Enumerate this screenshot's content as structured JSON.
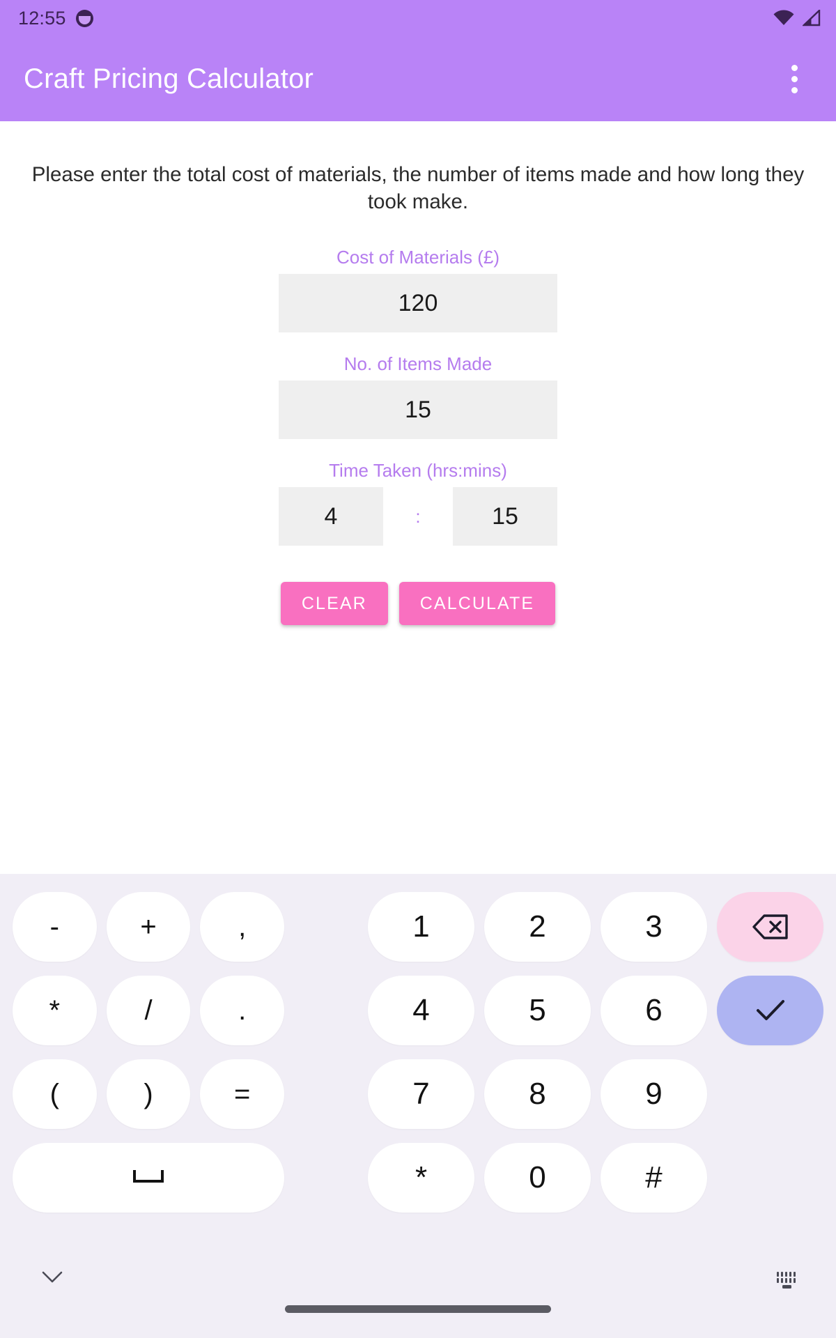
{
  "status_bar": {
    "time": "12:55",
    "notification_icon": "app-notification-icon",
    "wifi_icon": "wifi-icon",
    "signal_icon": "cellular-signal-icon"
  },
  "app_bar": {
    "title": "Craft Pricing Calculator",
    "overflow_icon": "more-vert-icon",
    "background_color": "#B983F7",
    "title_color": "#FFFFFF"
  },
  "content": {
    "intro_text": "Please enter the total cost of materials, the number of items made and how long they took make.",
    "label_color": "#B57CEE",
    "fields": {
      "cost": {
        "label": "Cost of Materials (£)",
        "value": "120",
        "placeholder": ""
      },
      "items": {
        "label": "No. of Items Made",
        "value": "15",
        "placeholder": ""
      },
      "time": {
        "label": "Time Taken (hrs:mins)",
        "hours": "4",
        "minutes": "15",
        "separator": ":",
        "hours_placeholder": "",
        "minutes_placeholder": ""
      }
    },
    "buttons": {
      "clear": "CLEAR",
      "calculate": "CALCULATE",
      "color": "#F970C0"
    }
  },
  "keyboard": {
    "background_color": "#F1EEF6",
    "backspace_key_color": "#FBD3E8",
    "enter_key_color": "#AEB4F2",
    "left_rows": [
      [
        "-",
        "+",
        ","
      ],
      [
        "*",
        "/",
        "."
      ],
      [
        "(",
        ")",
        "="
      ],
      [
        "␣"
      ]
    ],
    "right_rows": [
      [
        "1",
        "2",
        "3"
      ],
      [
        "4",
        "5",
        "6"
      ],
      [
        "7",
        "8",
        "9"
      ],
      [
        "*",
        "0",
        "#"
      ]
    ],
    "backspace_icon": "backspace-icon",
    "enter_icon": "check-icon",
    "space_icon": "space-bar-icon",
    "bottom": {
      "hide_keyboard_icon": "chevron-down-icon",
      "switch_keyboard_icon": "keyboard-switch-icon",
      "home_indicator": "home-indicator"
    }
  }
}
